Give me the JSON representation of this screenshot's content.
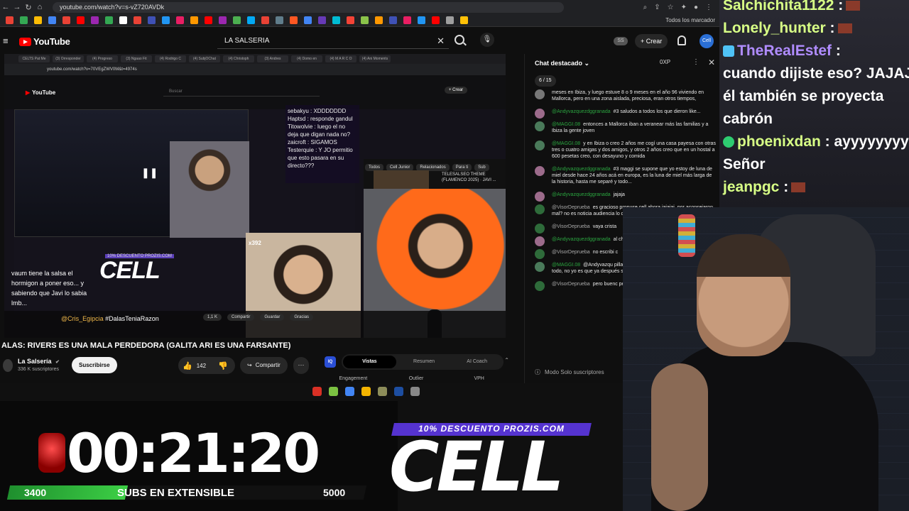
{
  "browser": {
    "url": "youtube.com/watch?v=s-vZ720AVDk",
    "bookmarks_label": "Todos los marcador",
    "bookmark_colors": [
      "#e94235",
      "#34a853",
      "#fbbc05",
      "#4285f4",
      "#e94235",
      "#ff0000",
      "#9c27b0",
      "#34a853",
      "#ffffff",
      "#e94235",
      "#3f51b5",
      "#2196f3",
      "#e91e63",
      "#ff9800",
      "#ff0000",
      "#9c27b0",
      "#4caf50",
      "#03a9f4",
      "#e94235",
      "#607d8b",
      "#ff5722",
      "#4285f4",
      "#673ab7",
      "#00bcd4",
      "#f44336",
      "#8bc34a",
      "#ff9800",
      "#3f51b5",
      "#e91e63",
      "#2196f3",
      "#ff0000",
      "#9e9e9e",
      "#ffc107"
    ]
  },
  "youtube": {
    "logo_text": "YouTube",
    "search_value": "LA SALSERIA",
    "ss_badge": "SS",
    "create_label": "+ Crear",
    "avatar_text": "Cell"
  },
  "inner_stream": {
    "inner_url": "youtube.com/watch?v=70VEgZWV0M&t=4974s",
    "inner_tabs": [
      "CELTS Pat Me",
      "(3) Orresponder",
      "(4) Progreso",
      "(3) Ngaao Fit",
      "(4) Rodrigo C",
      "(4) SubjOChat",
      "(4) Christoph",
      "(3) Andres",
      "(4) Domo en",
      "(4) M A R C O",
      "(4) Ani Moments"
    ],
    "inner_search_placeholder": "Buscar",
    "inner_crear": "+ Crear",
    "overlay_chat": [
      "sebakyu : XDDDDDDD",
      "Haptsd : responde gandul",
      "Titowolvie : luego el no deja que digan nada no?",
      "zaicroft : SIGAMOS",
      "Testerquie : Y JO permitio que esto pasara en su directo???"
    ],
    "cam_label": "x392",
    "side_tabs": [
      "Todos",
      "Cell Junior",
      "Relacionados",
      "Para ti",
      "Sub"
    ],
    "side_title": "TELESALSEO THEME (FLAMENCO 2025) · JAVI ...",
    "overlay_text": [
      "vaum tiene la salsa el",
      "hormigon a poner eso... y",
      "sabiendo que Javi lo sabia",
      "lmb..."
    ],
    "hashtag_user": "@Cris_Egipcia",
    "hashtag": "#DalasTeniaRazon",
    "small_promo": "10% DESCUENTO PROZIS.COM",
    "small_cell": "CELL",
    "inner_actions": [
      "1,1 K",
      "Compartir",
      "Guardar",
      "Gracias"
    ]
  },
  "video": {
    "title": "ALAS: RIVERS ES UNA MALA PERDEDORA (GALITA ARI ES UNA FARSANTE)",
    "channel_name": "La Salsería",
    "channel_verified": "✔",
    "channel_subs": "336 K suscriptores",
    "subscribe_label": "Suscribirse",
    "likes": "142",
    "share_label": "Compartir",
    "more_label": "···"
  },
  "insights": {
    "badge": "IQ",
    "tabs": [
      "Vistas",
      "Resumen",
      "AI Coach"
    ],
    "active_tab": "Vistas",
    "chevron": "⌃",
    "metrics": [
      "Engagement",
      "Outlier",
      "VPH"
    ]
  },
  "chat": {
    "title": "Chat destacado ⌄",
    "xp": "0XP",
    "level": "6 / 15",
    "footer": "Modo Solo suscriptores",
    "messages": [
      {
        "user": "",
        "text": "meses en Ibiza, y luego estuve 8 o 9 meses en el año 96 viviendo en Mallorca, pero en una zona aislada, preciosa, eran otros tiempos,",
        "color": "#777777",
        "user_gray": true
      },
      {
        "user": "@Andyvazquezdggranada",
        "text": "#3  saludos a todos los que dieron like...",
        "color": "#9c6b8b",
        "user_gray": false
      },
      {
        "user": "@MAGGI.08",
        "text": "entonces a Mallorca iban a veranear más las familias y a Ibiza la gente joven",
        "color": "#4a7a5a",
        "user_gray": false
      },
      {
        "user": "@MAGGI.08",
        "text": "y en Ibiza o creo 2 años me cogí una casa payesa con otras tres o cuatro amigas y dos amigos, y otros 2 años creo que en un hostal a 600 pesetas creo, con desayuno y comida",
        "color": "#4a7a5a",
        "user_gray": false
      },
      {
        "user": "@Andyvazquezdggranada",
        "text": "#3  maggi se supone que yo estoy de luna de miel desde hace 24 años acá en europa, es la luna de miel más larga de la historia, hasta me separé y todo...",
        "color": "#9c6b8b",
        "user_gray": false
      },
      {
        "user": "@Andyvazquezdggranada",
        "text": "jajaja",
        "color": "#9c6b8b",
        "user_gray": false
      },
      {
        "user": "@VisorDepruebа",
        "text": "es gracioso propuse cell ahora jajajaj, por aconsejaron mal? no es noticia audiencia lo que te beneficia?",
        "color": "#2e6b3a",
        "user_gray": true
      },
      {
        "user": "@VisorDepruebа",
        "text": "vaya crista",
        "color": "#2e6b3a",
        "user_gray": true
      },
      {
        "user": "@Andyvazquezdggranada",
        "text": "al chat cuando termino el dire",
        "color": "#9c6b8b",
        "user_gray": false
      },
      {
        "user": "@VisorDepruebа",
        "text": "no escribi c",
        "color": "#2e6b3a",
        "user_gray": true
      },
      {
        "user": "@MAGGI.08",
        "text": "@Andyvazqu pillado, fuiste de luna de miel separado y todo, no yo es que ya después salí de España",
        "color": "#4a7a5a",
        "user_gray": false
      },
      {
        "user": "@VisorDepruebа",
        "text": "pero buenc perro",
        "color": "#2e6b3a",
        "user_gray": true
      }
    ]
  },
  "dock_colors": [
    "#d93025",
    "#7cc242",
    "#4285f4",
    "#f4b400",
    "#8d8d5a",
    "#1d4ea1",
    "#888888"
  ],
  "timer": {
    "value": "00:21:20",
    "subs_min": "3400",
    "subs_label": "SUBS EN EXTENSIBLE",
    "subs_max": "5000",
    "progress": 0.33
  },
  "promo": {
    "banner": "10% DESCUENTO PROZIS.COM",
    "brand": "CELL"
  },
  "side_chat": [
    {
      "user": "Salchichita1122",
      "text": " :",
      "cls": "sc-user",
      "icon": "none",
      "emote": true
    },
    {
      "user": "Lonely_hunter",
      "text": " :",
      "cls": "sc-user",
      "icon": "none",
      "emote": true
    },
    {
      "user": "TheRealEstef",
      "text": " :",
      "cls": "sc-user2",
      "icon": "blue",
      "emote": false
    },
    {
      "user": "",
      "text": "cuando dijiste eso? JAJAJ",
      "cls": "",
      "icon": "none",
      "emote": false
    },
    {
      "user": "",
      "text": "él también se proyecta",
      "cls": "",
      "icon": "none",
      "emote": false
    },
    {
      "user": "",
      "text": "cabrón",
      "cls": "",
      "icon": "none",
      "emote": false
    },
    {
      "user": "phoenixdan",
      "text": " : ayyyyyyyy",
      "cls": "sc-user",
      "icon": "green",
      "emote": false
    },
    {
      "user": "",
      "text": "Señor",
      "cls": "",
      "icon": "none",
      "emote": false
    },
    {
      "user": "jeanpgc",
      "text": " :",
      "cls": "sc-user",
      "icon": "none",
      "emote": true
    }
  ]
}
